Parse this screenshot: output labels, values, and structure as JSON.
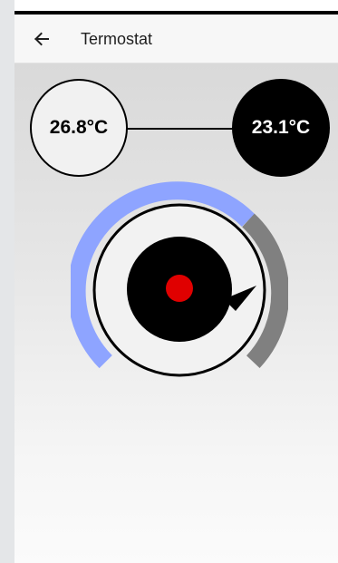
{
  "app_bar": {
    "title": "Termostat",
    "back_icon": "arrow-left-icon"
  },
  "thermostat": {
    "current_temperature": "26.8°C",
    "target_temperature": "23.1°C"
  },
  "colors": {
    "heating_arc": "#8ea4ff",
    "cooling_arc": "#808080",
    "indicator": "#e00000",
    "knob": "#000000"
  }
}
